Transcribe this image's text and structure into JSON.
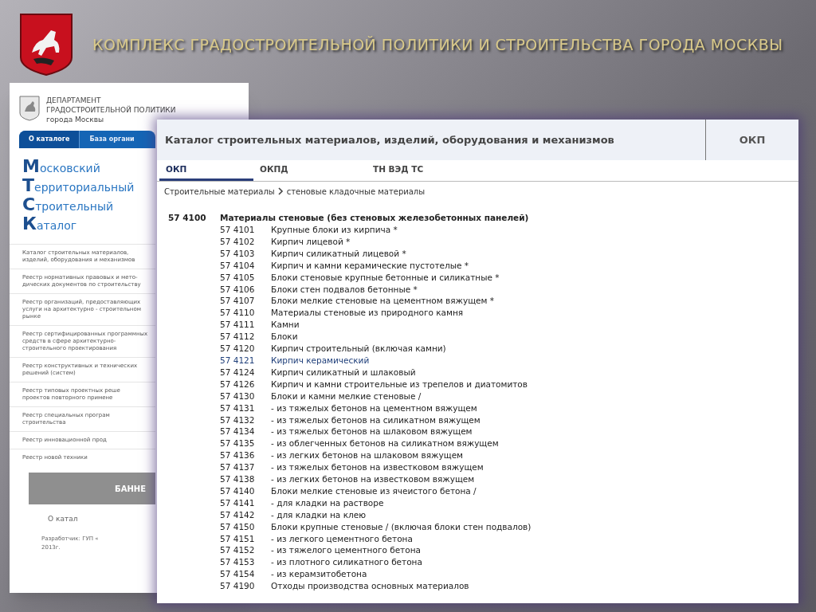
{
  "slide": {
    "title": "КОМПЛЕКС ГРАДОСТРОИТЕЛЬНОЙ ПОЛИТИКИ И СТРОИТЕЛЬСТВА  ГОРОДА МОСКВЫ"
  },
  "back_page": {
    "department": [
      "ДЕПАРТАМЕНТ",
      "ГРАДОСТРОИТЕЛЬНОЙ ПОЛИТИКИ",
      "города Москвы"
    ],
    "tabs": [
      {
        "label": "О каталоге",
        "selected": true
      },
      {
        "label": "База органи",
        "selected": false
      }
    ],
    "catalog_name": [
      "Московский",
      "Территориальный",
      "Строительный",
      "Каталог"
    ],
    "menu": [
      "Каталог строительных материалов, изделий, оборудования и механизмов",
      "Реестр нормативных правовых и мето-дических документов по строительству",
      "Реестр организаций, предоставляющих услуги на архитектурно - строительном рынке",
      "Реестр сертифицированных программных средств в сфере архитектурно-строительного проектирования",
      "Реестр конструктивных и технических решений (систем)",
      "Реестр типовых проектных реше проектов повторного примене",
      "Реестр специальных програм строительства",
      "Реестр инновационной прод",
      "Реестр новой техники"
    ],
    "banner": "БАННЕ",
    "about_link": "О катал",
    "footer": [
      "Разработчик: ГУП «",
      "2013г."
    ]
  },
  "catalog": {
    "title": "Каталог строительных материалов, изделий, оборудования и механизмов",
    "badge": "ОКП",
    "tabs": [
      {
        "label": "ОКП",
        "selected": true
      },
      {
        "label": "ОКПД",
        "selected": false
      },
      {
        "label": "ТН ВЭД ТС",
        "selected": false
      }
    ],
    "breadcrumb": [
      "Строительные материалы",
      "стеновые кладочные материалы"
    ],
    "group": {
      "code": "57 4100",
      "name": "Материалы стеновые (без стеновых железобетонных панелей)"
    },
    "rows": [
      {
        "code": "57 4101",
        "name": "Крупные блоки из кирпича *",
        "highlighted": false
      },
      {
        "code": "57 4102",
        "name": "Кирпич лицевой *",
        "highlighted": false
      },
      {
        "code": "57 4103",
        "name": "Кирпич силикатный лицевой *",
        "highlighted": false
      },
      {
        "code": "57 4104",
        "name": "Кирпич и камни керамические пустотелые *",
        "highlighted": false
      },
      {
        "code": "57 4105",
        "name": "Блоки стеновые крупные бетонные и силикатные *",
        "highlighted": false
      },
      {
        "code": "57 4106",
        "name": "Блоки стен подвалов бетонные *",
        "highlighted": false
      },
      {
        "code": "57 4107",
        "name": "Блоки мелкие стеновые на цементном вяжущем *",
        "highlighted": false
      },
      {
        "code": "57 4110",
        "name": "Материалы стеновые из природного камня",
        "highlighted": false
      },
      {
        "code": "57 4111",
        "name": "Камни",
        "highlighted": false
      },
      {
        "code": "57 4112",
        "name": "Блоки",
        "highlighted": false
      },
      {
        "code": "57 4120",
        "name": "Кирпич строительный (включая камни)",
        "highlighted": false
      },
      {
        "code": "57 4121",
        "name": "Кирпич керамический",
        "highlighted": true
      },
      {
        "code": "57 4124",
        "name": "Кирпич силикатный и шлаковый",
        "highlighted": false
      },
      {
        "code": "57 4126",
        "name": "Кирпич и камни строительные из трепелов и диатомитов",
        "highlighted": false
      },
      {
        "code": "57 4130",
        "name": "Блоки и камни мелкие стеновые /",
        "highlighted": false
      },
      {
        "code": "57 4131",
        "name": "- из тяжелых бетонов на цементном вяжущем",
        "highlighted": false
      },
      {
        "code": "57 4132",
        "name": "- из тяжелых бетонов на силикатном вяжущем",
        "highlighted": false
      },
      {
        "code": "57 4134",
        "name": "- из тяжелых бетонов на шлаковом вяжущем",
        "highlighted": false
      },
      {
        "code": "57 4135",
        "name": "- из облегченных бетонов на силикатном вяжущем",
        "highlighted": false
      },
      {
        "code": "57 4136",
        "name": "- из легких бетонов на шлаковом вяжущем",
        "highlighted": false
      },
      {
        "code": "57 4137",
        "name": "- из тяжелых бетонов на известковом вяжущем",
        "highlighted": false
      },
      {
        "code": "57 4138",
        "name": "- из легких бетонов на известковом вяжущем",
        "highlighted": false
      },
      {
        "code": "57 4140",
        "name": "Блоки мелкие стеновые из ячеистого бетона /",
        "highlighted": false
      },
      {
        "code": "57 4141",
        "name": "- для кладки на растворе",
        "highlighted": false
      },
      {
        "code": "57 4142",
        "name": "- для кладки на клею",
        "highlighted": false
      },
      {
        "code": "57 4150",
        "name": "Блоки крупные стеновые / (включая блоки стен подвалов)",
        "highlighted": false
      },
      {
        "code": "57 4151",
        "name": "- из легкого цементного бетона",
        "highlighted": false
      },
      {
        "code": "57 4152",
        "name": "- из тяжелого цементного бетона",
        "highlighted": false
      },
      {
        "code": "57 4153",
        "name": "- из плотного силикатного бетона",
        "highlighted": false
      },
      {
        "code": "57 4154",
        "name": "- из керамзитобетона",
        "highlighted": false
      },
      {
        "code": "57 4190",
        "name": "Отходы производства основных материалов",
        "highlighted": false
      }
    ]
  }
}
